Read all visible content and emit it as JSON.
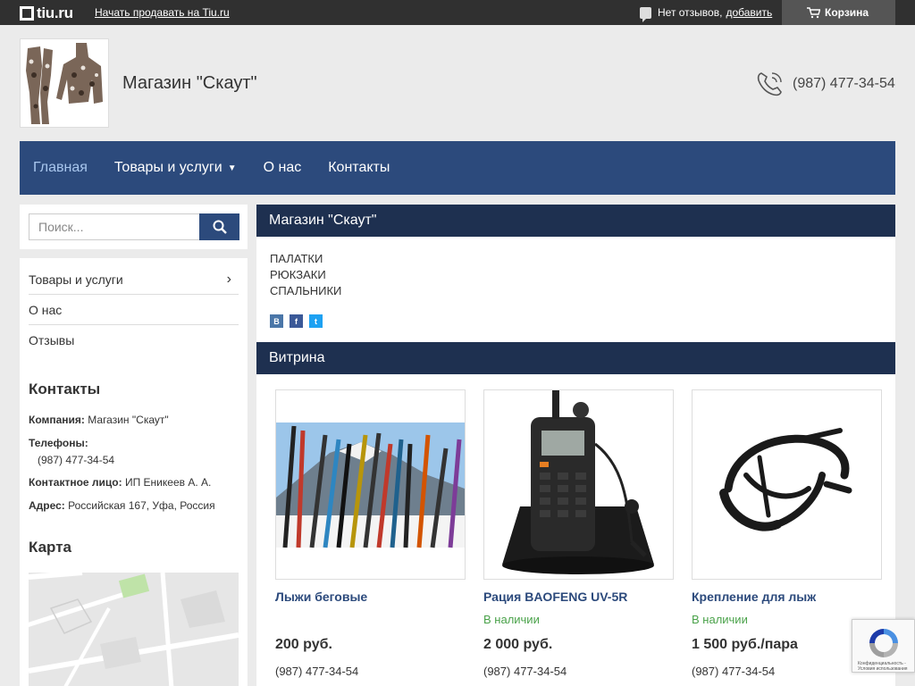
{
  "topbar": {
    "logo": "tiu.ru",
    "sell_link": "Начать продавать на Tiu.ru",
    "reviews_text": "Нет отзывов,",
    "reviews_link": "добавить",
    "cart_label": "Корзина"
  },
  "header": {
    "shop_name": "Магазин \"Скаут\"",
    "phone": "(987) 477-34-54"
  },
  "nav": {
    "items": [
      {
        "label": "Главная",
        "active": true
      },
      {
        "label": "Товары и услуги"
      },
      {
        "label": "О нас"
      },
      {
        "label": "Контакты"
      }
    ]
  },
  "search": {
    "placeholder": "Поиск..."
  },
  "sidebar": {
    "links": [
      "Товары и услуги",
      "О нас",
      "Отзывы"
    ],
    "contacts_title": "Контакты",
    "company_label": "Компания:",
    "company_value": "Магазин \"Скаут\"",
    "phones_label": "Телефоны:",
    "phones_value": "(987) 477-34-54",
    "person_label": "Контактное лицо:",
    "person_value": "ИП Еникеев А. А.",
    "address_label": "Адрес:",
    "address_value": "Российская 167, Уфа, Россия",
    "map_title": "Карта"
  },
  "about": {
    "title": "Магазин \"Скаут\"",
    "categories": [
      "ПАЛАТКИ",
      "РЮКЗАКИ",
      "СПАЛЬНИКИ"
    ],
    "social": [
      "В",
      "f",
      "t"
    ]
  },
  "showcase": {
    "title": "Витрина",
    "products": [
      {
        "name": "Лыжи беговые",
        "stock": "",
        "price": "200 руб.",
        "phone": "(987) 477-34-54"
      },
      {
        "name": "Рация BAOFENG UV-5R",
        "stock": "В наличии",
        "price": "2 000 руб.",
        "phone": "(987) 477-34-54"
      },
      {
        "name": "Крепление для лыж",
        "stock": "В наличии",
        "price": "1 500 руб./пара",
        "phone": "(987) 477-34-54"
      }
    ]
  },
  "recaptcha": {
    "text": "Конфиденциальность - Условия использования"
  },
  "colors": {
    "nav": "#2c4a7c",
    "header_bar": "#1e3050",
    "stock": "#4aa24a",
    "topbar": "#303030"
  }
}
